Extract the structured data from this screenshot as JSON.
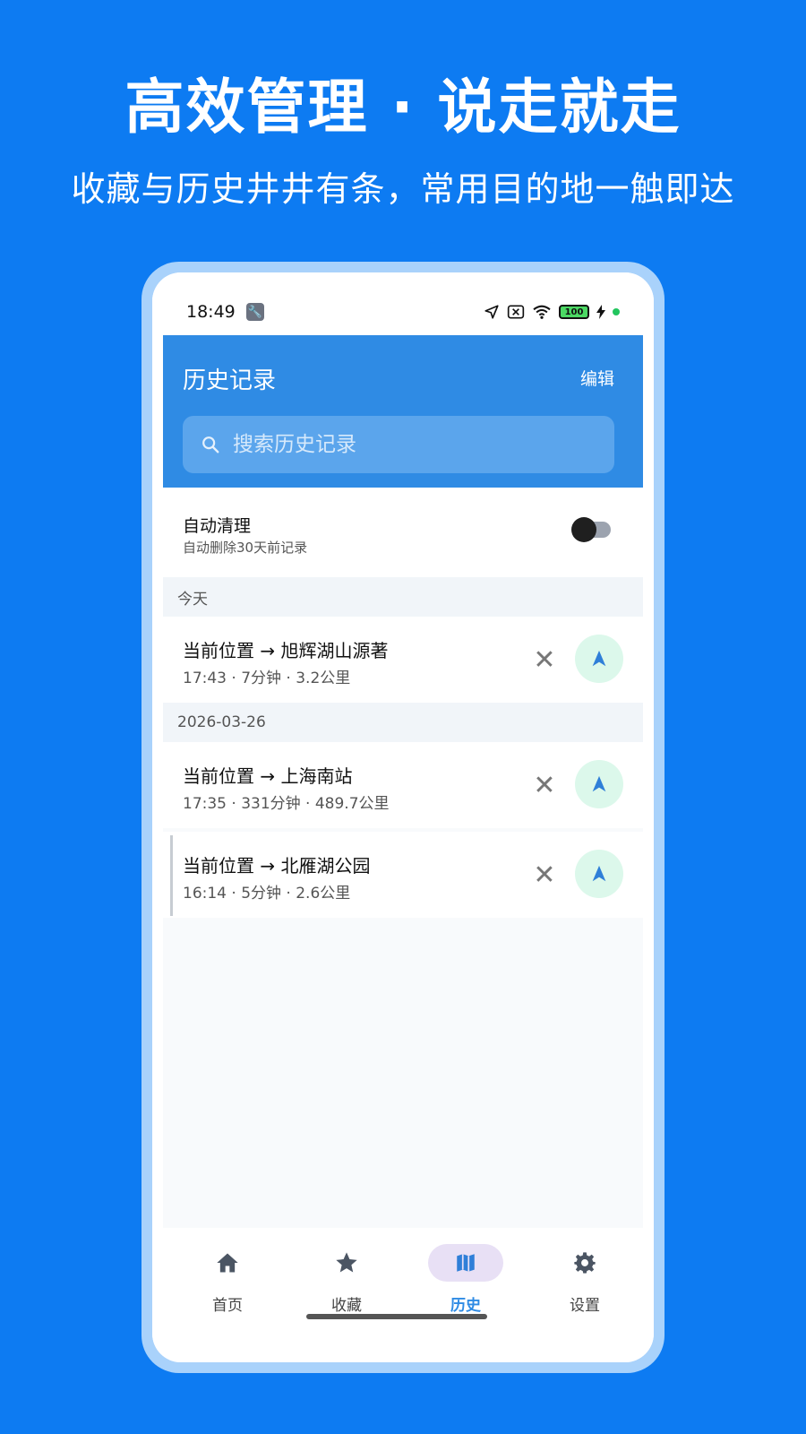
{
  "promo": {
    "headline": "高效管理 · 说走就走",
    "subline": "收藏与历史井井有条，常用目的地一触即达"
  },
  "statusbar": {
    "time": "18:49",
    "battery": "100"
  },
  "appbar": {
    "title": "历史记录",
    "edit_label": "编辑",
    "search_placeholder": "搜索历史记录"
  },
  "auto_clean": {
    "title": "自动清理",
    "subtitle": "自动删除30天前记录",
    "enabled": false
  },
  "groups": [
    {
      "header": "今天",
      "items": [
        {
          "route": "当前位置 → 旭辉湖山源著",
          "meta": "17:43 · 7分钟 · 3.2公里"
        }
      ]
    },
    {
      "header": "2026-03-26",
      "items": [
        {
          "route": "当前位置 → 上海南站",
          "meta": "17:35 · 331分钟 · 489.7公里"
        },
        {
          "route": "当前位置 → 北雁湖公园",
          "meta": "16:14 · 5分钟 · 2.6公里"
        }
      ]
    }
  ],
  "bottom_nav": [
    {
      "label": "首页",
      "icon": "home-icon"
    },
    {
      "label": "收藏",
      "icon": "star-icon"
    },
    {
      "label": "历史",
      "icon": "map-icon",
      "active": true
    },
    {
      "label": "设置",
      "icon": "gear-icon"
    }
  ],
  "colors": {
    "background": "#0d7bf2",
    "appbar": "#2f8be4",
    "nav_button": "#dcf8eb",
    "active_tab_pill": "#e8e0f5"
  }
}
